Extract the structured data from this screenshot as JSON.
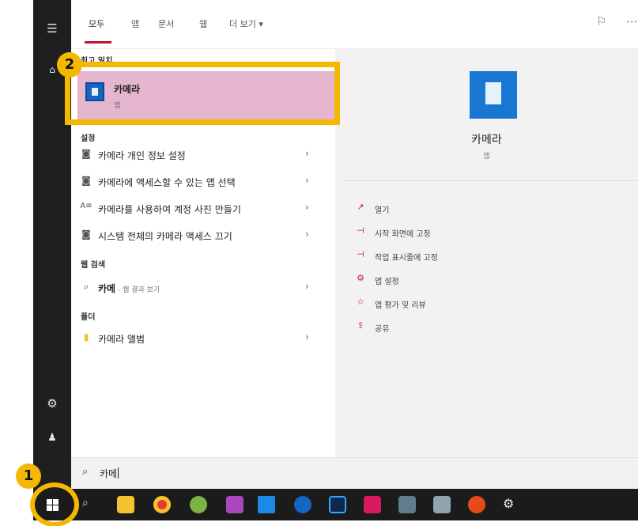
{
  "tabs": [
    "모두",
    "앱",
    "문서",
    "웹",
    "더 보기 ▾"
  ],
  "sections": {
    "best": "최고 일치",
    "settings": "설정",
    "web": "웹 검색",
    "folders": "폴더"
  },
  "best_match": {
    "title": "카메라",
    "subtitle": "앱"
  },
  "settings_items": [
    "카메라 개인 정보 설정",
    "카메라에 액세스할 수 있는 앱 선택",
    "카메라를 사용하여 계정 사진 만들기",
    "시스템 전체의 카메라 액세스 끄기"
  ],
  "web_item": {
    "query": "카메",
    "suffix": " - 웹 결과 보기"
  },
  "folder_item": "카메라 앨범",
  "detail": {
    "title": "카메라",
    "subtitle": "앱",
    "actions": [
      "열기",
      "시작 화면에 고정",
      "작업 표시줄에 고정",
      "앱 설정",
      "앱 평가 및 리뷰",
      "공유"
    ]
  },
  "search": {
    "value": "카메"
  },
  "badges": [
    "1",
    "2"
  ],
  "colors": {
    "highlight": "#e6b6cf",
    "callout": "#f5b800",
    "accent": "#c8102e"
  },
  "icons": {
    "hamburger": "☰",
    "settings": "⚙",
    "user": "👤",
    "search": "⌕",
    "chevron": "›"
  }
}
